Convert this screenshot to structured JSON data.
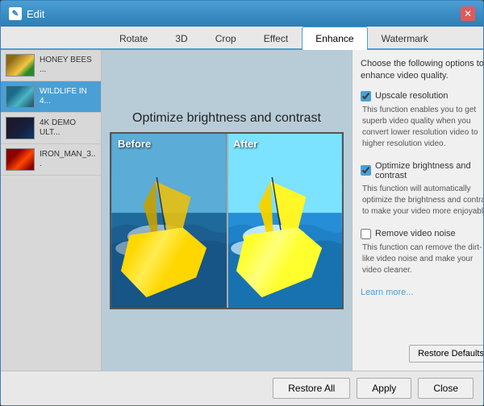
{
  "window": {
    "title": "Edit",
    "icon": "E"
  },
  "tabs": [
    {
      "label": "Rotate",
      "active": false
    },
    {
      "label": "3D",
      "active": false
    },
    {
      "label": "Crop",
      "active": false
    },
    {
      "label": "Effect",
      "active": false
    },
    {
      "label": "Enhance",
      "active": true
    },
    {
      "label": "Watermark",
      "active": false
    }
  ],
  "sidebar": {
    "items": [
      {
        "label": "HONEY BEES ...",
        "thumb": "bees",
        "active": false
      },
      {
        "label": "WILDLIFE IN 4...",
        "thumb": "wildlife",
        "active": true
      },
      {
        "label": "4K DEMO ULT...",
        "thumb": "4k",
        "active": false
      },
      {
        "label": "IRON_MAN_3...",
        "thumb": "ironman",
        "active": false
      }
    ]
  },
  "preview": {
    "title": "Optimize brightness and contrast",
    "before_label": "Before",
    "after_label": "After"
  },
  "right_panel": {
    "description": "Choose the following options to enhance video quality.",
    "options": [
      {
        "id": "upscale",
        "label": "Upscale resolution",
        "checked": true,
        "description": "This function enables you to get superb video quality when you convert lower resolution video to higher resolution video."
      },
      {
        "id": "brightness",
        "label": "Optimize brightness and contrast",
        "checked": true,
        "description": "This function will automatically optimize the brightness and contrast to make your video more enjoyable."
      },
      {
        "id": "noise",
        "label": "Remove video noise",
        "checked": false,
        "description": "This function can remove the dirt-like video noise and make your video cleaner."
      }
    ],
    "learn_more": "Learn more...",
    "restore_defaults_btn": "Restore Defaults"
  },
  "bottom_bar": {
    "restore_all_btn": "Restore All",
    "apply_btn": "Apply",
    "close_btn": "Close"
  }
}
